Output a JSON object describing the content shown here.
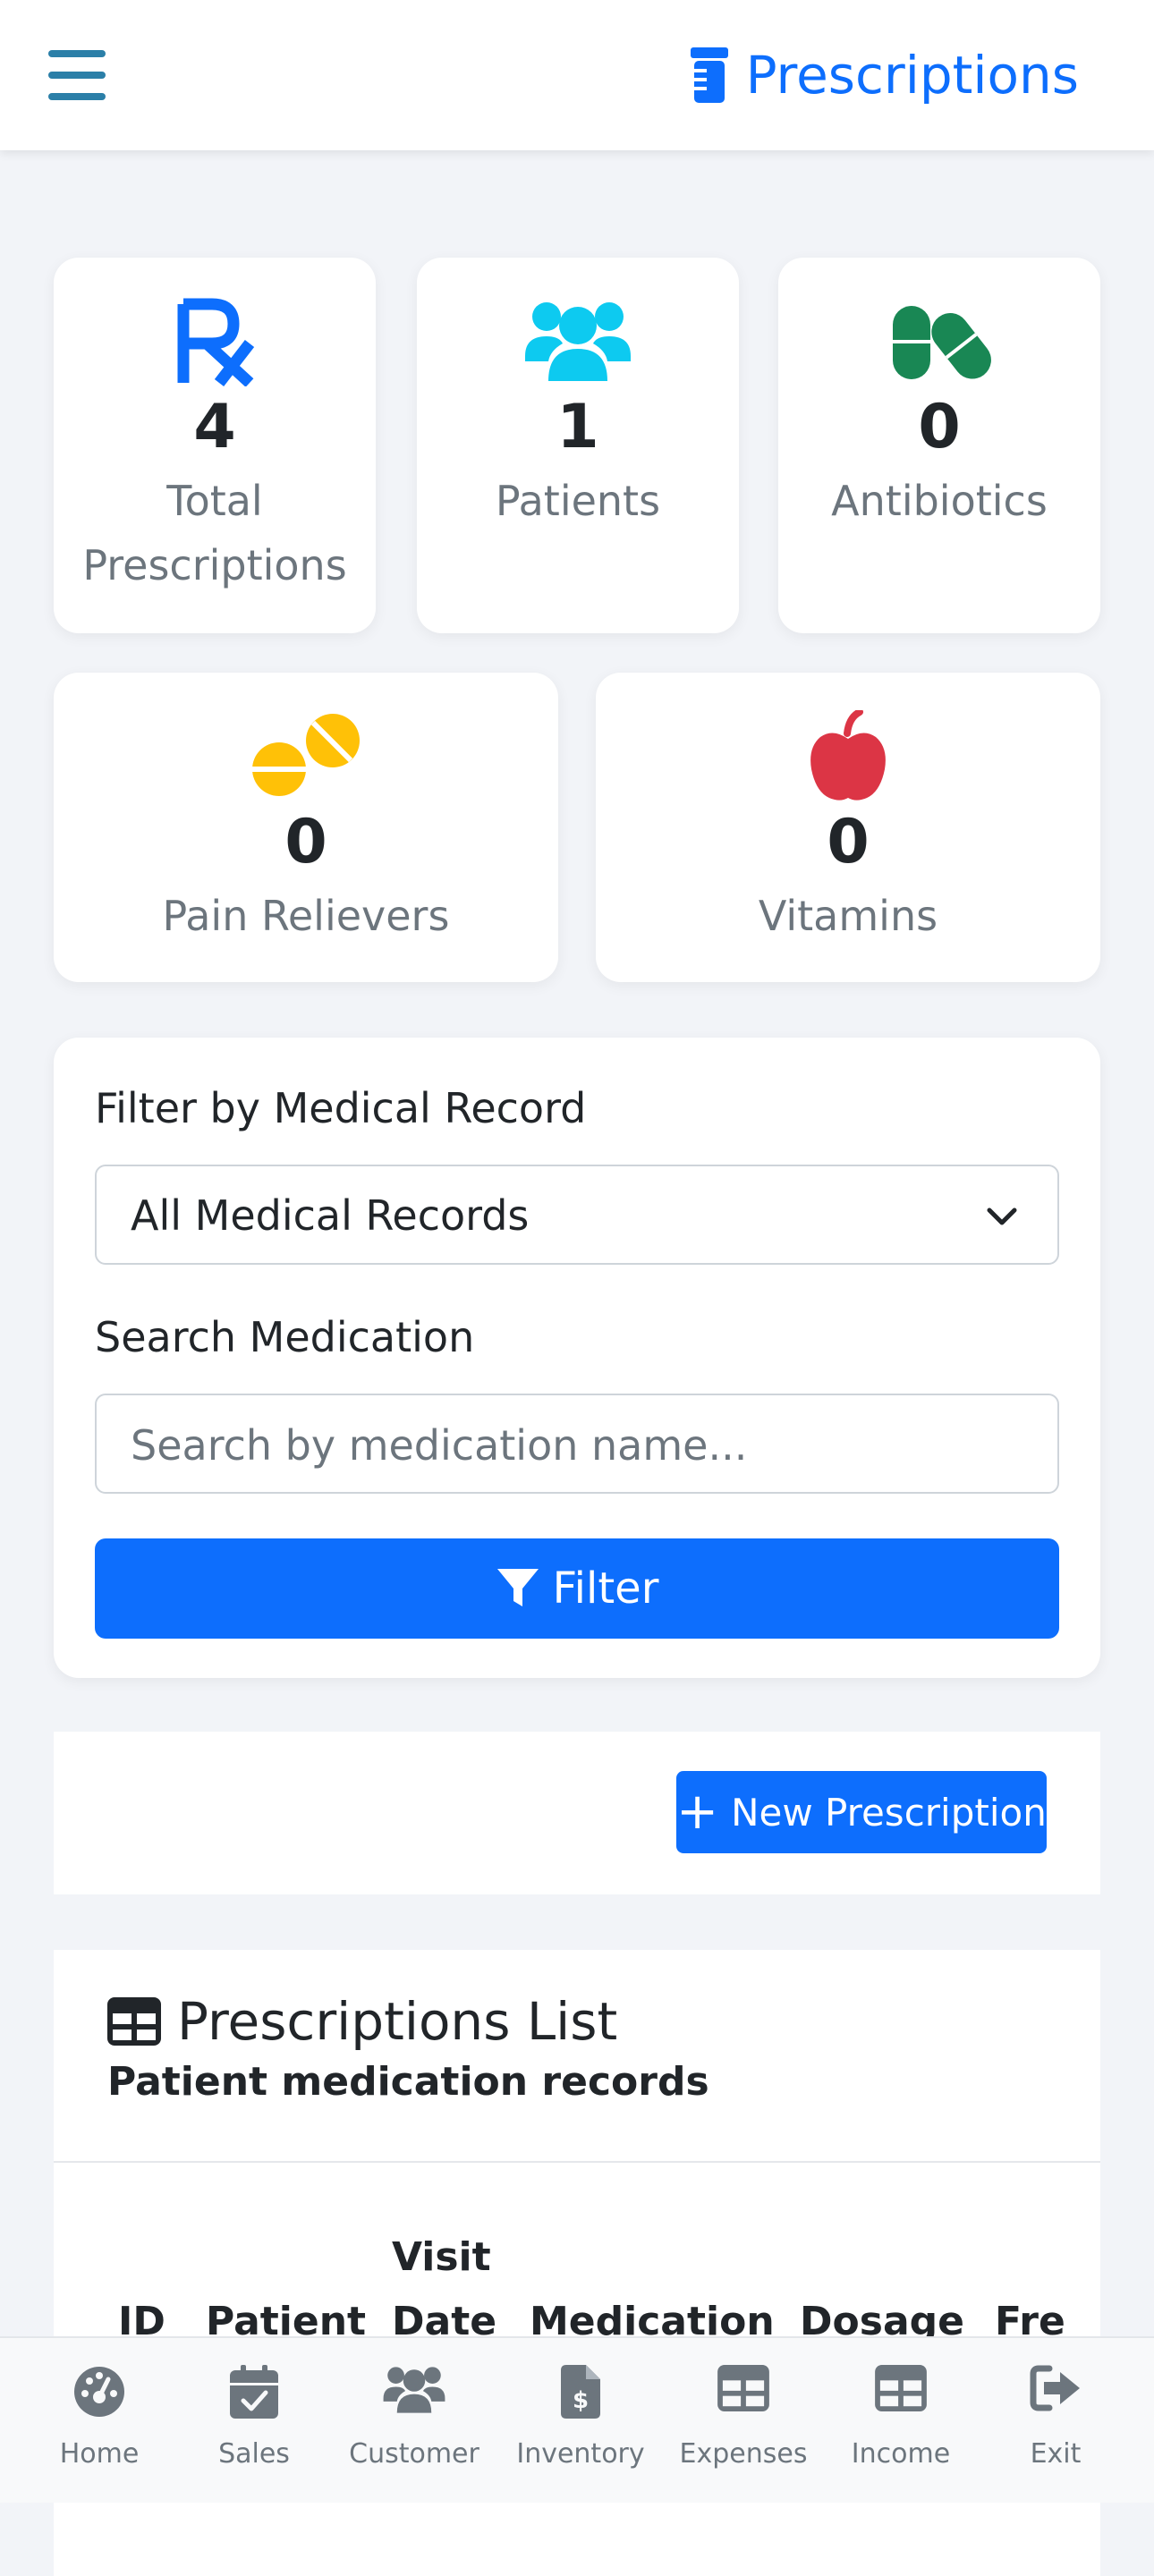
{
  "header": {
    "title": "Prescriptions",
    "title_icon": "prescription-bottle-icon",
    "menu_icon": "hamburger-menu-icon",
    "accent": "#0d6efd"
  },
  "stats": [
    {
      "icon": "rx-icon",
      "value": "4",
      "label_lines": [
        "Total",
        "Prescriptions"
      ],
      "color": "#0d6efd"
    },
    {
      "icon": "users-icon",
      "value": "1",
      "label_lines": [
        "Patients"
      ],
      "color": "#0dcaf0"
    },
    {
      "icon": "capsules-icon",
      "value": "0",
      "label_lines": [
        "Antibiotics"
      ],
      "color": "#198754"
    },
    {
      "icon": "tablets-icon",
      "value": "0",
      "label_lines": [
        "Pain Relievers"
      ],
      "color": "#ffc107"
    },
    {
      "icon": "apple-icon",
      "value": "0",
      "label_lines": [
        "Vitamins"
      ],
      "color": "#dc3545"
    }
  ],
  "filter": {
    "record_label": "Filter by Medical Record",
    "record_selected": "All Medical Records",
    "search_label": "Search Medication",
    "search_value": "",
    "search_placeholder": "Search by medication name...",
    "button_label": "Filter"
  },
  "actions": {
    "new_button": "New Prescription"
  },
  "list": {
    "title": "Prescriptions List",
    "subtitle": "Patient medication records",
    "columns": [
      "ID",
      "Patient",
      "Visit",
      "Date",
      "Medication",
      "Dosage",
      "Fre"
    ]
  },
  "bottom_nav": [
    {
      "label": "Home",
      "icon": "dashboard-icon"
    },
    {
      "label": "Sales",
      "icon": "calendar-check-icon"
    },
    {
      "label": "Customer",
      "icon": "users-icon"
    },
    {
      "label": "Inventory",
      "icon": "file-invoice-dollar-icon"
    },
    {
      "label": "Expenses",
      "icon": "table-icon"
    },
    {
      "label": "Income",
      "icon": "table-icon"
    },
    {
      "label": "Exit",
      "icon": "sign-out-icon"
    }
  ]
}
